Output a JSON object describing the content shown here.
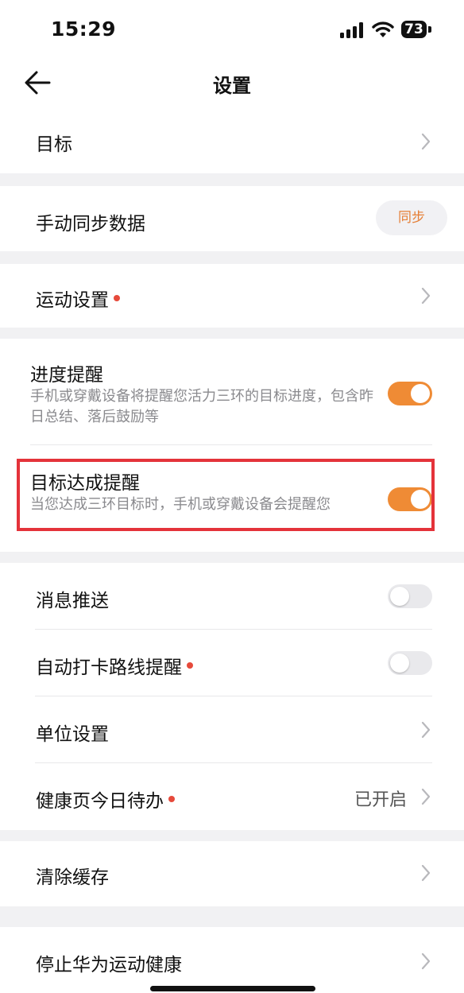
{
  "status_bar": {
    "time": "15:29",
    "battery": "73"
  },
  "header": {
    "title": "设置"
  },
  "rows": {
    "goal": "目标",
    "manual_sync": "手动同步数据",
    "sync_button": "同步",
    "exercise_settings": "运动设置",
    "progress_reminder": {
      "title": "进度提醒",
      "desc": "手机或穿戴设备将提醒您活力三环的目标进度，包含昨日总结、落后鼓励等",
      "enabled": true
    },
    "goal_achieved_reminder": {
      "title": "目标达成提醒",
      "desc": "当您达成三环目标时，手机或穿戴设备会提醒您",
      "enabled": true
    },
    "push_notifications": {
      "label": "消息推送",
      "enabled": false
    },
    "auto_checkin_route": {
      "label": "自动打卡路线提醒",
      "enabled": false
    },
    "unit_settings": "单位设置",
    "health_todo": {
      "label": "健康页今日待办",
      "value": "已开启"
    },
    "clear_cache": "清除缓存",
    "stop_service": "停止华为运动健康"
  },
  "colors": {
    "accent": "#ef8b35",
    "dot": "#e64a3b",
    "highlight": "#e4333a"
  }
}
